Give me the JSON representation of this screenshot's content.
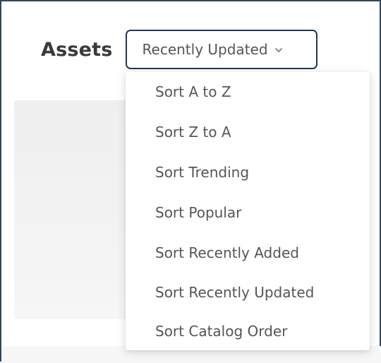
{
  "header": {
    "title": "Assets",
    "sort_select": {
      "selected_label": "Recently Updated",
      "icon": "chevron-down-icon"
    }
  },
  "sort_menu": {
    "items": [
      {
        "label": "Sort A to Z"
      },
      {
        "label": "Sort Z to A"
      },
      {
        "label": "Sort Trending"
      },
      {
        "label": "Sort Popular"
      },
      {
        "label": "Sort Recently Added"
      },
      {
        "label": "Sort Recently Updated"
      },
      {
        "label": "Sort Catalog Order"
      }
    ]
  },
  "colors": {
    "frame_border": "#2f465e",
    "select_border": "#203a56",
    "text": "#555555",
    "title_text": "#3a3a3a"
  }
}
